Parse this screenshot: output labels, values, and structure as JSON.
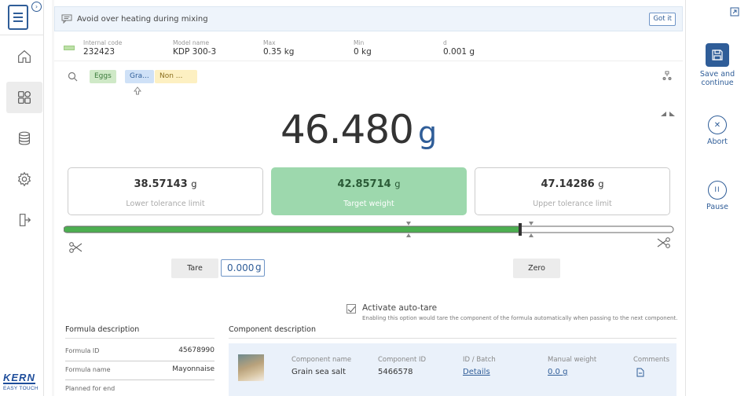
{
  "sidebar": {
    "items": [
      {
        "name": "home-icon",
        "active": false
      },
      {
        "name": "dashboard-icon",
        "active": true
      },
      {
        "name": "database-icon",
        "active": false
      },
      {
        "name": "settings-icon",
        "active": false
      },
      {
        "name": "logout-icon",
        "active": false
      }
    ],
    "brand": "KERN",
    "brand_sub": "EASY TOUCH"
  },
  "notice": {
    "message": "Avoid over heating during mixing",
    "dismiss_label": "Got it"
  },
  "info": {
    "internal_code_label": "Internal code",
    "internal_code": "232423",
    "model_name_label": "Model name",
    "model_name": "KDP 300-3",
    "max_label": "Max",
    "max": "0.35 kg",
    "min_label": "Min",
    "min": "0 kg",
    "d_label": "d",
    "d": "0.001 g"
  },
  "chips": [
    {
      "label": "Eggs",
      "color": "green"
    },
    {
      "label": "Gra...",
      "color": "blue"
    },
    {
      "label": "Non ...",
      "color": "yellow"
    }
  ],
  "weight": {
    "value": "46.480",
    "unit": "g"
  },
  "tolerance": {
    "lower_value": "38.57143",
    "lower_unit": "g",
    "lower_label": "Lower tolerance limit",
    "target_value": "42.85714",
    "target_unit": "g",
    "target_label": "Target weight",
    "upper_value": "47.14286",
    "upper_unit": "g",
    "upper_label": "Upper tolerance limit"
  },
  "progress": {
    "fill_fraction": 0.75
  },
  "controls": {
    "tare_label": "Tare",
    "tare_value": "0.000",
    "tare_unit": "g",
    "zero_label": "Zero"
  },
  "autotare": {
    "checked": true,
    "label": "Activate auto-tare",
    "hint": "Enabling this option would tare the component of the formula automatically when passing to the next component."
  },
  "formula": {
    "section_title": "Formula description",
    "rows": [
      {
        "key": "Formula ID",
        "value": "45678990"
      },
      {
        "key": "Formula name",
        "value": "Mayonnaise"
      },
      {
        "key": "Planned for end",
        "value": ""
      }
    ]
  },
  "component": {
    "section_title": "Component description",
    "name_label": "Component name",
    "name": "Grain sea salt",
    "id_label": "Component ID",
    "id": "5466578",
    "batch_label": "ID / Batch",
    "batch_link": "Details",
    "manual_label": "Manual weight",
    "manual_value": "0.0 g",
    "comments_label": "Comments"
  },
  "actions": {
    "save_label": "Save and continue",
    "abort_label": "Abort",
    "pause_label": "Pause"
  },
  "colors": {
    "accent": "#2f5d98",
    "progress": "#4caf50",
    "target": "#9dd8ad"
  }
}
